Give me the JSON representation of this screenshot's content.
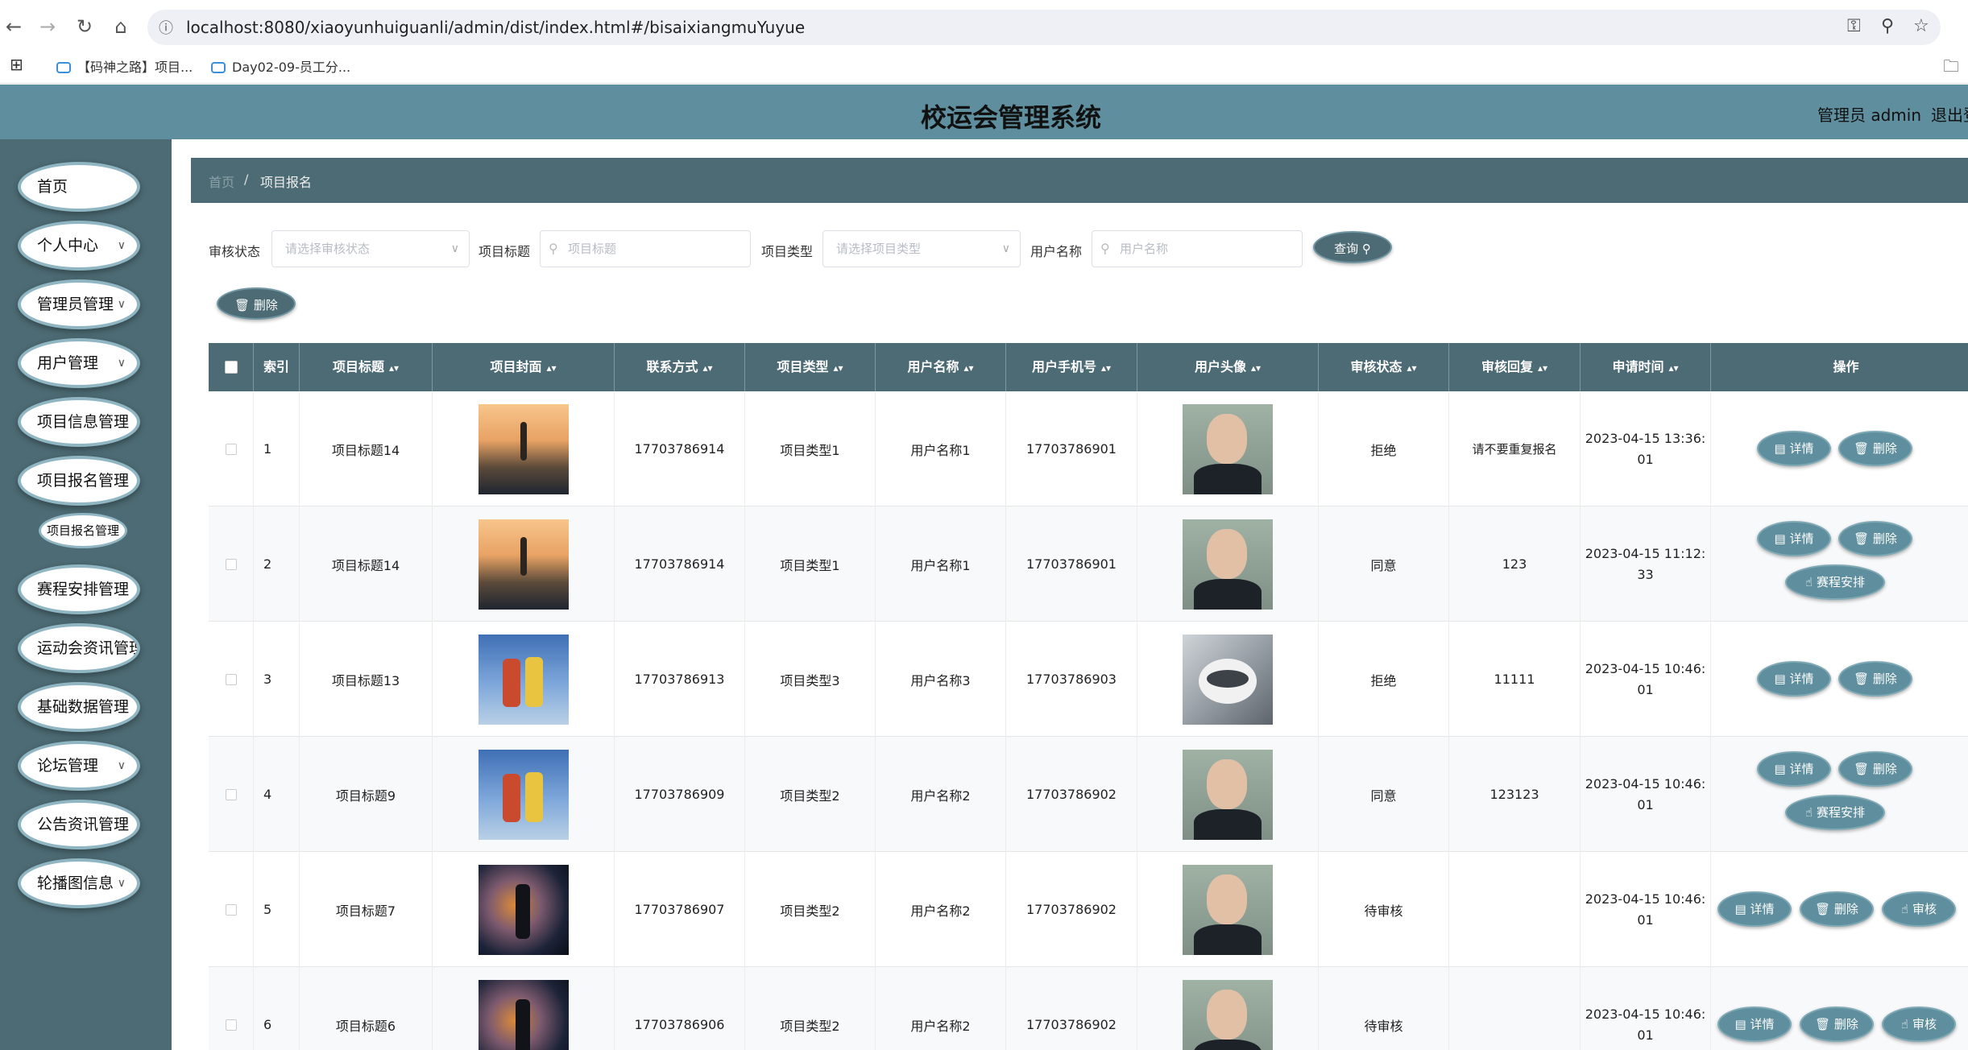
{
  "browser": {
    "url": "localhost:8080/xiaoyunhuiguanli/admin/dist/index.html#/bisaixiangmuYuyue",
    "bookmarks": [
      "【码神之路】项目...",
      "Day02-09-员工分..."
    ]
  },
  "header": {
    "title": "校运会管理系统",
    "user": "管理员 admin",
    "logout": "退出登录"
  },
  "sidebar": {
    "items": [
      {
        "label": "首页"
      },
      {
        "label": "个人中心"
      },
      {
        "label": "管理员管理"
      },
      {
        "label": "用户管理"
      },
      {
        "label": "项目信息管理"
      },
      {
        "label": "项目报名管理"
      },
      {
        "label": "赛程安排管理"
      },
      {
        "label": "运动会资讯管理"
      },
      {
        "label": "基础数据管理"
      },
      {
        "label": "论坛管理"
      },
      {
        "label": "公告资讯管理"
      },
      {
        "label": "轮播图信息"
      }
    ],
    "sub_item": "项目报名管理"
  },
  "breadcrumb": {
    "home": "首页",
    "separator": "/",
    "current": "项目报名"
  },
  "filters": {
    "audit_label": "审核状态",
    "audit_placeholder": "请选择审核状态",
    "title_label": "项目标题",
    "title_placeholder": "项目标题",
    "type_label": "项目类型",
    "type_placeholder": "请选择项目类型",
    "user_label": "用户名称",
    "user_placeholder": "用户名称",
    "search_button": "查询"
  },
  "toolbar": {
    "delete_button": "删除"
  },
  "table": {
    "headers": [
      "索引",
      "项目标题",
      "项目封面",
      "联系方式",
      "项目类型",
      "用户名称",
      "用户手机号",
      "用户头像",
      "审核状态",
      "审核回复",
      "申请时间",
      "操作"
    ],
    "action_labels": {
      "detail": "详情",
      "delete": "删除",
      "schedule": "赛程安排",
      "audit": "审核"
    },
    "rows": [
      {
        "index": "1",
        "title": "项目标题14",
        "phone": "17703786914",
        "type": "项目类型1",
        "user": "用户名称1",
        "user_phone": "17703786901",
        "status": "拒绝",
        "reply": "请不要重复报名",
        "time_1": "2023-04-15 13:36:",
        "time_2": "01"
      },
      {
        "index": "2",
        "title": "项目标题14",
        "phone": "17703786914",
        "type": "项目类型1",
        "user": "用户名称1",
        "user_phone": "17703786901",
        "status": "同意",
        "reply": "123",
        "time_1": "2023-04-15 11:12:",
        "time_2": "33"
      },
      {
        "index": "3",
        "title": "项目标题13",
        "phone": "17703786913",
        "type": "项目类型3",
        "user": "用户名称3",
        "user_phone": "17703786903",
        "status": "拒绝",
        "reply": "11111",
        "time_1": "2023-04-15 10:46:",
        "time_2": "01"
      },
      {
        "index": "4",
        "title": "项目标题9",
        "phone": "17703786909",
        "type": "项目类型2",
        "user": "用户名称2",
        "user_phone": "17703786902",
        "status": "同意",
        "reply": "123123",
        "time_1": "2023-04-15 10:46:",
        "time_2": "01"
      },
      {
        "index": "5",
        "title": "项目标题7",
        "phone": "17703786907",
        "type": "项目类型2",
        "user": "用户名称2",
        "user_phone": "17703786902",
        "status": "待审核",
        "reply": "",
        "time_1": "2023-04-15 10:46:",
        "time_2": "01"
      },
      {
        "index": "6",
        "title": "项目标题6",
        "phone": "17703786906",
        "type": "项目类型2",
        "user": "用户名称2",
        "user_phone": "17703786902",
        "status": "待审核",
        "reply": "",
        "time_1": "2023-04-15 10:46:",
        "time_2": "01"
      }
    ]
  }
}
